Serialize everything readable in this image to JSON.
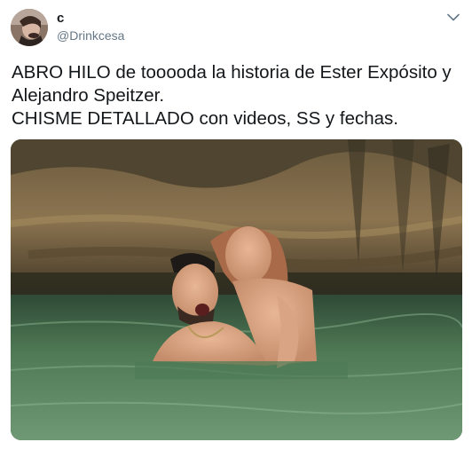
{
  "author": {
    "display_name": "c",
    "handle": "@Drinkcesa",
    "avatar_icon": "profile-avatar"
  },
  "tweet": {
    "lines": [
      "ABRO HILO de tooooda la historia de Ester Expósito y",
      "Alejandro Speitzer.",
      "CHISME DETALLADO con videos, SS y fechas."
    ]
  },
  "menu": {
    "icon": "chevron-down-icon"
  },
  "media": {
    "description_icon": "photo"
  },
  "colors": {
    "text": "#14171a",
    "secondary": "#657786",
    "caret": "#657786"
  }
}
